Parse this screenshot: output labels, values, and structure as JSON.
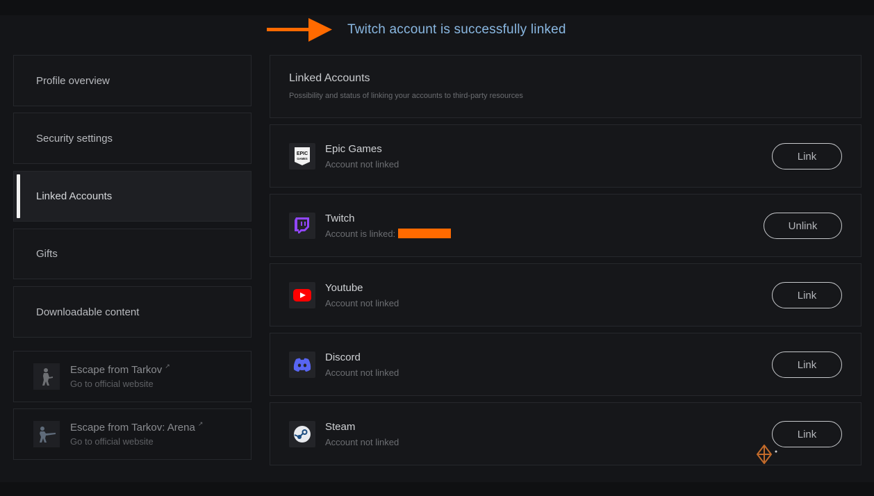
{
  "notice": {
    "text": "Twitch account is successfully linked"
  },
  "sidebar": {
    "items": [
      {
        "label": "Profile overview"
      },
      {
        "label": "Security settings"
      },
      {
        "label": "Linked Accounts"
      },
      {
        "label": "Gifts"
      },
      {
        "label": "Downloadable content"
      }
    ],
    "external": [
      {
        "title": "Escape from Tarkov",
        "subtitle": "Go to official website"
      },
      {
        "title": "Escape from Tarkov: Arena",
        "subtitle": "Go to official website"
      }
    ]
  },
  "main": {
    "title": "Linked Accounts",
    "subtitle": "Possibility and status of linking your accounts to third-party resources",
    "accounts": [
      {
        "name": "Epic Games",
        "status": "Account not linked",
        "button": "Link",
        "icon": "epic-games-icon"
      },
      {
        "name": "Twitch",
        "status": "Account is linked:",
        "button": "Unlink",
        "icon": "twitch-icon"
      },
      {
        "name": "Youtube",
        "status": "Account not linked",
        "button": "Link",
        "icon": "youtube-icon"
      },
      {
        "name": "Discord",
        "status": "Account not linked",
        "button": "Link",
        "icon": "discord-icon"
      },
      {
        "name": "Steam",
        "status": "Account not linked",
        "button": "Link",
        "icon": "steam-icon"
      }
    ]
  },
  "colors": {
    "background": "#141518",
    "notice_text": "#8ab8e2",
    "annotation_arrow": "#ff6a00",
    "twitch": "#9146ff",
    "youtube": "#ff0000",
    "discord": "#5865f2"
  }
}
